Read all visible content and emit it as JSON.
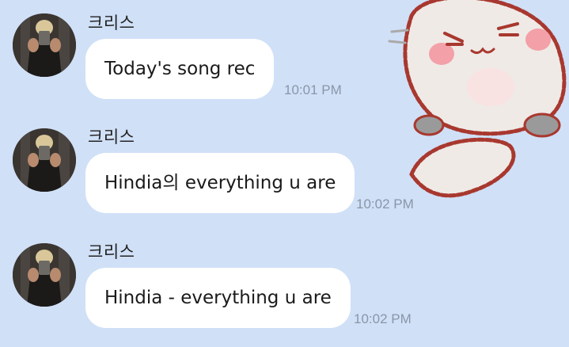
{
  "messages": [
    {
      "sender": "크리스",
      "text": "Today's song rec",
      "time": "10:01 PM"
    },
    {
      "sender": "크리스",
      "text": "Hindia의 everything u are",
      "time": "10:02 PM"
    },
    {
      "sender": "크리스",
      "text": "Hindia - everything u are",
      "time": "10:02 PM"
    }
  ],
  "sticker": {
    "icon": "cute-cat-sticker-icon"
  },
  "colors": {
    "background": "#d0e0f7",
    "bubble": "#ffffff",
    "time": "#8a96a8"
  }
}
